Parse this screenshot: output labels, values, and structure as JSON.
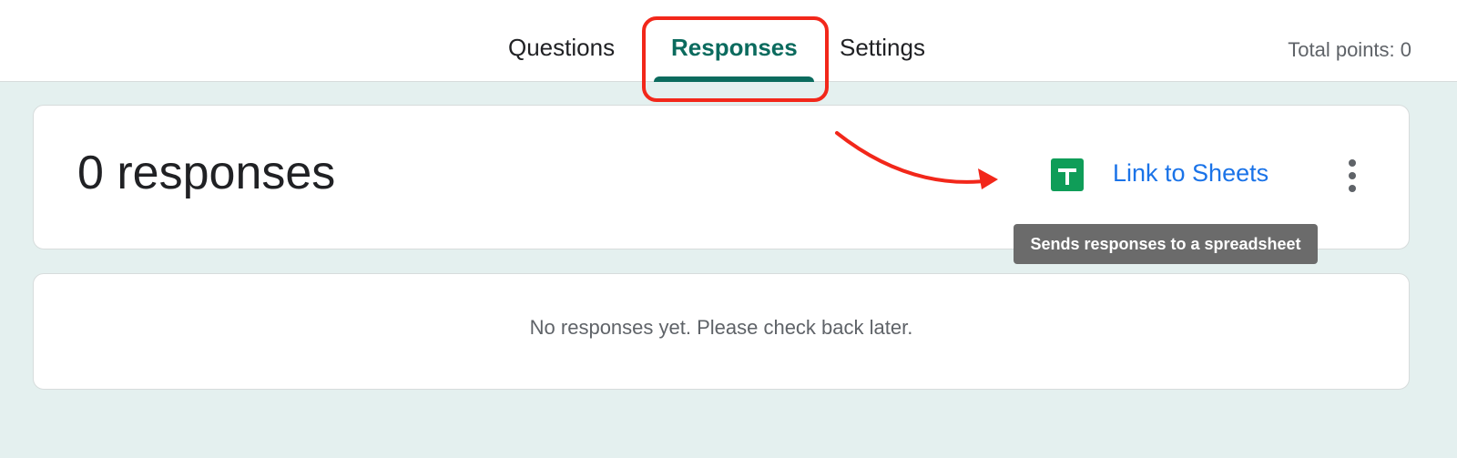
{
  "header": {
    "tabs": [
      {
        "label": "Questions"
      },
      {
        "label": "Responses"
      },
      {
        "label": "Settings"
      }
    ],
    "total_points": "Total points: 0"
  },
  "summary": {
    "response_count": "0 responses",
    "link_to_sheets": "Link to Sheets",
    "tooltip": "Sends responses to a spreadsheet"
  },
  "empty_state": {
    "message": "No responses yet. Please check back later."
  },
  "colors": {
    "active_tab": "#0b6b5e",
    "link": "#1a73e8",
    "sheets_icon": "#0f9d58",
    "annotation": "#f2271a",
    "background": "#e4f0ef"
  },
  "icons": {
    "sheets": "google-sheets-icon",
    "more": "more-vert-icon"
  }
}
